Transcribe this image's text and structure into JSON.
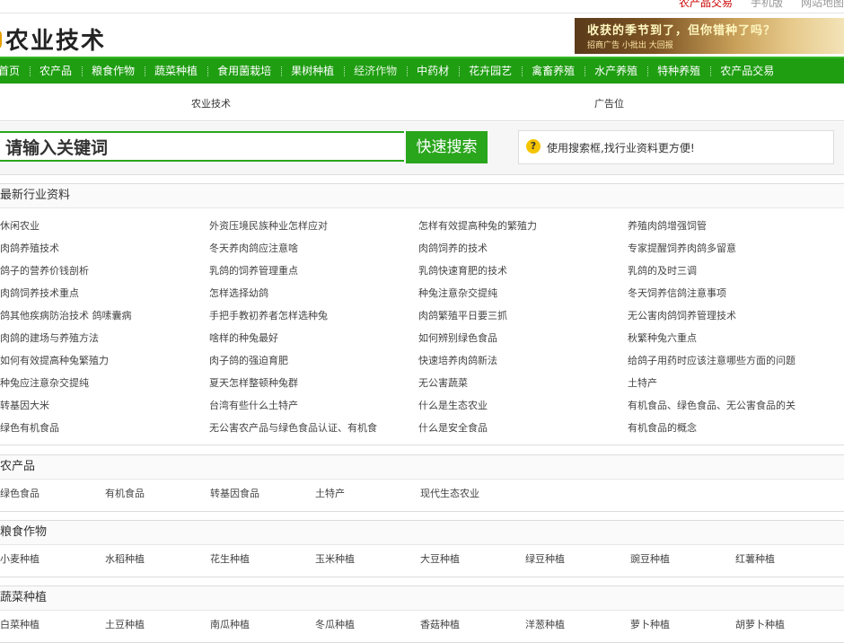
{
  "top_links": [
    "农产品交易",
    "手机版",
    "网站地图"
  ],
  "logo": {
    "text": "农业技术"
  },
  "banner": {
    "line1": "收获的季节到了，但你错种了吗？",
    "line2": "招商广告 小批出 大回报"
  },
  "nav": [
    "首页",
    "农产品",
    "粮食作物",
    "蔬菜种植",
    "食用菌栽培",
    "果树种植",
    "经济作物",
    "中药材",
    "花卉园艺",
    "禽畜养殖",
    "水产养殖",
    "特种养殖",
    "农产品交易"
  ],
  "ad_row": {
    "left": "农业技术",
    "right": "广告位"
  },
  "search": {
    "placeholder": "请输入关键词",
    "button": "快速搜索",
    "tip": "使用搜索框,找行业资料更方便!"
  },
  "latest": {
    "title": "最新行业资料",
    "items": [
      "休闲农业",
      "外资压境民族种业怎样应对",
      "怎样有效提高种兔的繁殖力",
      "养殖肉鸽增强饲管",
      "肉鸽养殖技术",
      "冬天养肉鸽应注意啥",
      "肉鸽饲养的技术",
      "专家提醒饲养肉鸽多留意",
      "鸽子的营养价钱剖析",
      "乳鸽的饲养管理重点",
      "乳鸽快速育肥的技术",
      "乳鸽的及时三调",
      "肉鸽饲养技术重点",
      "怎样选择幼鸽",
      "种兔注意杂交提纯",
      "冬天饲养信鸽注意事项",
      "鸽其他疾病防治技术 鸽嗉囊病",
      "手把手教初养者怎样选种兔",
      "肉鸽繁殖平日要三抓",
      "无公害肉鸽饲养管理技术",
      "肉鸽的建场与养殖方法",
      "啥样的种兔最好",
      "如何辨别绿色食品",
      "秋繁种兔六重点",
      "如何有效提高种兔繁殖力",
      "肉子鸽的强迫育肥",
      "快速培养肉鸽新法",
      "给鸽子用药时应该注意哪些方面的问题",
      "种兔应注意杂交提纯",
      "夏天怎样整顿种兔群",
      "无公害蔬菜",
      "土特产",
      "转基因大米",
      "台湾有些什么土特产",
      "什么是生态农业",
      "有机食品、绿色食品、无公害食品的关",
      "绿色有机食品",
      "无公害农产品与绿色食品认证、有机食",
      "什么是安全食品",
      "有机食品的概念"
    ]
  },
  "sections": [
    {
      "title": "农产品",
      "items": [
        "绿色食品",
        "有机食品",
        "转基因食品",
        "土特产",
        "现代生态农业"
      ]
    },
    {
      "title": "粮食作物",
      "items": [
        "小麦种植",
        "水稻种植",
        "花生种植",
        "玉米种植",
        "大豆种植",
        "绿豆种植",
        "豌豆种植",
        "红薯种植"
      ]
    },
    {
      "title": "蔬菜种植",
      "items": [
        "白菜种植",
        "土豆种植",
        "南瓜种植",
        "冬瓜种植",
        "香菇种植",
        "洋葱种植",
        "萝卜种植",
        "胡萝卜种植"
      ]
    }
  ]
}
